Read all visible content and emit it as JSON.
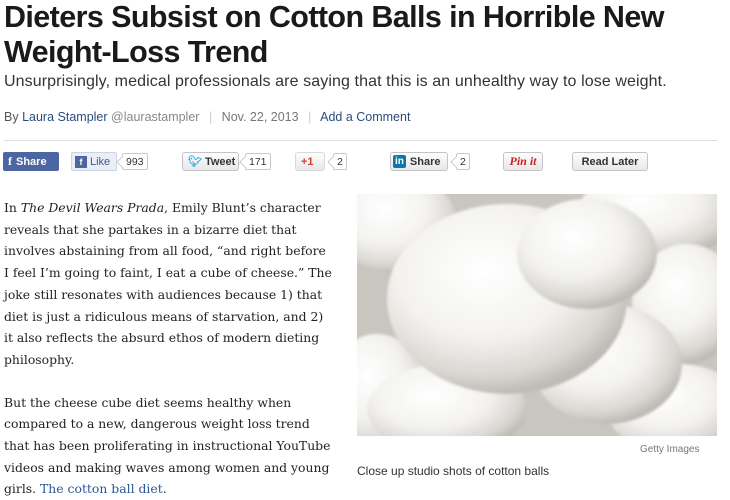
{
  "article": {
    "headline_line1": "Dieters Subsist on Cotton Balls in Horrible New",
    "headline_line2": "Weight-Loss Trend",
    "subhead": "Unsurprisingly, medical professionals are saying that this is an unhealthy way to lose weight.",
    "byline": {
      "by": "By",
      "author": "Laura Stampler",
      "handle": "@laurastampler",
      "date": "Nov. 22, 2013",
      "comment_link": "Add a Comment"
    }
  },
  "share_bar": {
    "facebook_share": "Share",
    "facebook_like": "Like",
    "facebook_like_count": "993",
    "tweet": "Tweet",
    "tweet_count": "171",
    "gplus": "+1",
    "gplus_count": "2",
    "linkedin": "Share",
    "linkedin_count": "2",
    "pinit": "Pin it",
    "read_later": "Read Later"
  },
  "body": {
    "p1_intro": "In ",
    "p1_title": "The Devil Wears Prada",
    "p1_rest": ", Emily Blunt’s character reveals that she partakes in a bizarre diet that involves abstaining from all food, “and right before I feel I’m going to faint, I eat a cube of cheese.” The joke still resonates with audiences because 1) that diet is just a ridiculous means of starvation, and 2) it also reflects the absurd ethos of modern dieting philosophy.",
    "p2_text": "But the cheese cube diet seems healthy when compared to a new, dangerous weight loss trend that has been proliferating in instructional YouTube videos and making waves among women and young girls. ",
    "p2_link": "The cotton ball diet",
    "p2_end": "."
  },
  "image": {
    "credit": "Getty Images",
    "caption": "Close up studio shots of cotton balls"
  },
  "icons": {
    "facebook": "facebook-icon",
    "like": "thumbs-up-icon",
    "twitter": "twitter-bird-icon",
    "gplus": "google-plus-icon",
    "linkedin": "linkedin-icon",
    "pinterest": "pinterest-icon"
  }
}
